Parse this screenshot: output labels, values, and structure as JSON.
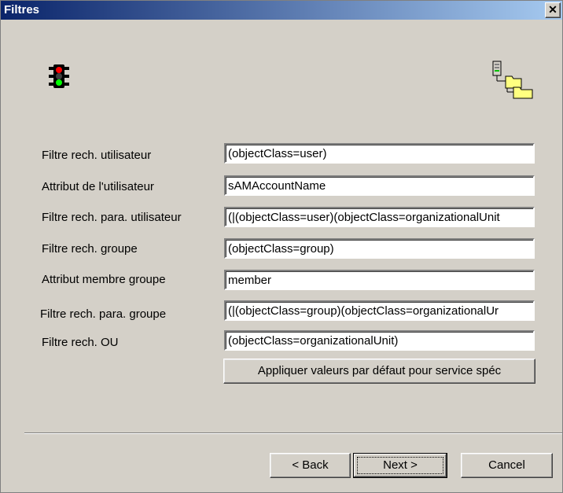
{
  "window": {
    "title": "Filtres"
  },
  "icons": {
    "left": "traffic-light-icon",
    "right": "directory-tree-icon"
  },
  "fields": [
    {
      "label": "Filtre rech. utilisateur",
      "value": "(objectClass=user)"
    },
    {
      "label": "Attribut de l'utilisateur",
      "value": "sAMAccountName"
    },
    {
      "label": "Filtre rech. para. utilisateur",
      "value": "(|(objectClass=user)(objectClass=organizationalUnit"
    },
    {
      "label": "Filtre rech. groupe",
      "value": "(objectClass=group)"
    },
    {
      "label": "Attribut membre groupe",
      "value": "member"
    },
    {
      "label": "Filtre rech. para. groupe",
      "value": "(|(objectClass=group)(objectClass=organizationalUr"
    },
    {
      "label": "Filtre rech. OU",
      "value": "(objectClass=organizationalUnit)"
    }
  ],
  "buttons": {
    "apply_defaults": "Appliquer valeurs par défaut pour service spéc",
    "back": "< Back",
    "next": "Next >",
    "cancel": "Cancel",
    "close": "✕"
  }
}
